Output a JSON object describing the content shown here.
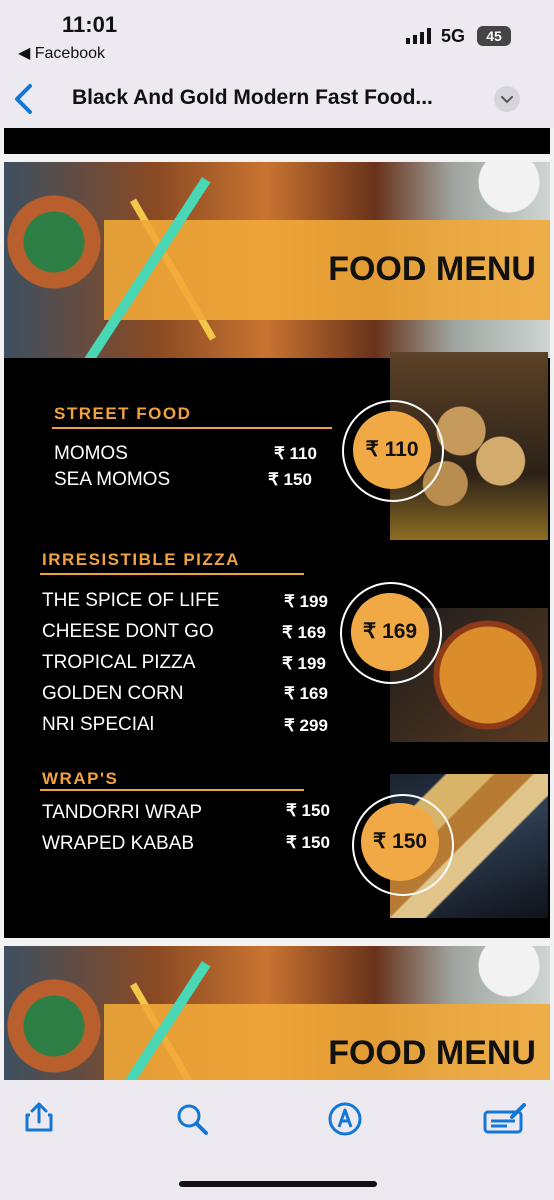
{
  "status": {
    "time": "11:01",
    "back_app": "Facebook",
    "network": "5G",
    "battery": "45"
  },
  "nav": {
    "title": "Black And Gold Modern Fast Food..."
  },
  "menu": {
    "banner_title": "FOOD MENU",
    "sections": [
      {
        "title": "STREET FOOD",
        "items": [
          {
            "name": "MOMOS",
            "price": "₹ 110"
          },
          {
            "name": "SEA MOMOS",
            "price": "₹ 150"
          }
        ],
        "badge": "₹ 110"
      },
      {
        "title": "IRRESISTIBLE PIZZA",
        "items": [
          {
            "name": "THE SPICE OF LIFE",
            "price": "₹ 199"
          },
          {
            "name": "CHEESE DONT GO",
            "price": "₹ 169"
          },
          {
            "name": "TROPICAL PIZZA",
            "price": "₹ 199"
          },
          {
            "name": "GOLDEN CORN",
            "price": "₹ 169"
          },
          {
            "name": "NRI SPECIAl",
            "price": "₹ 299"
          }
        ],
        "badge": "₹ 169"
      },
      {
        "title": "WRAP'S",
        "items": [
          {
            "name": "TANDORRI WRAP",
            "price": "₹ 150"
          },
          {
            "name": "WRAPED KABAB",
            "price": "₹ 150"
          }
        ],
        "badge": "₹ 150"
      }
    ],
    "next_banner_title": "FOOD MENU"
  },
  "colors": {
    "accent": "#f0a23e",
    "toolbar": "#1377d6"
  }
}
